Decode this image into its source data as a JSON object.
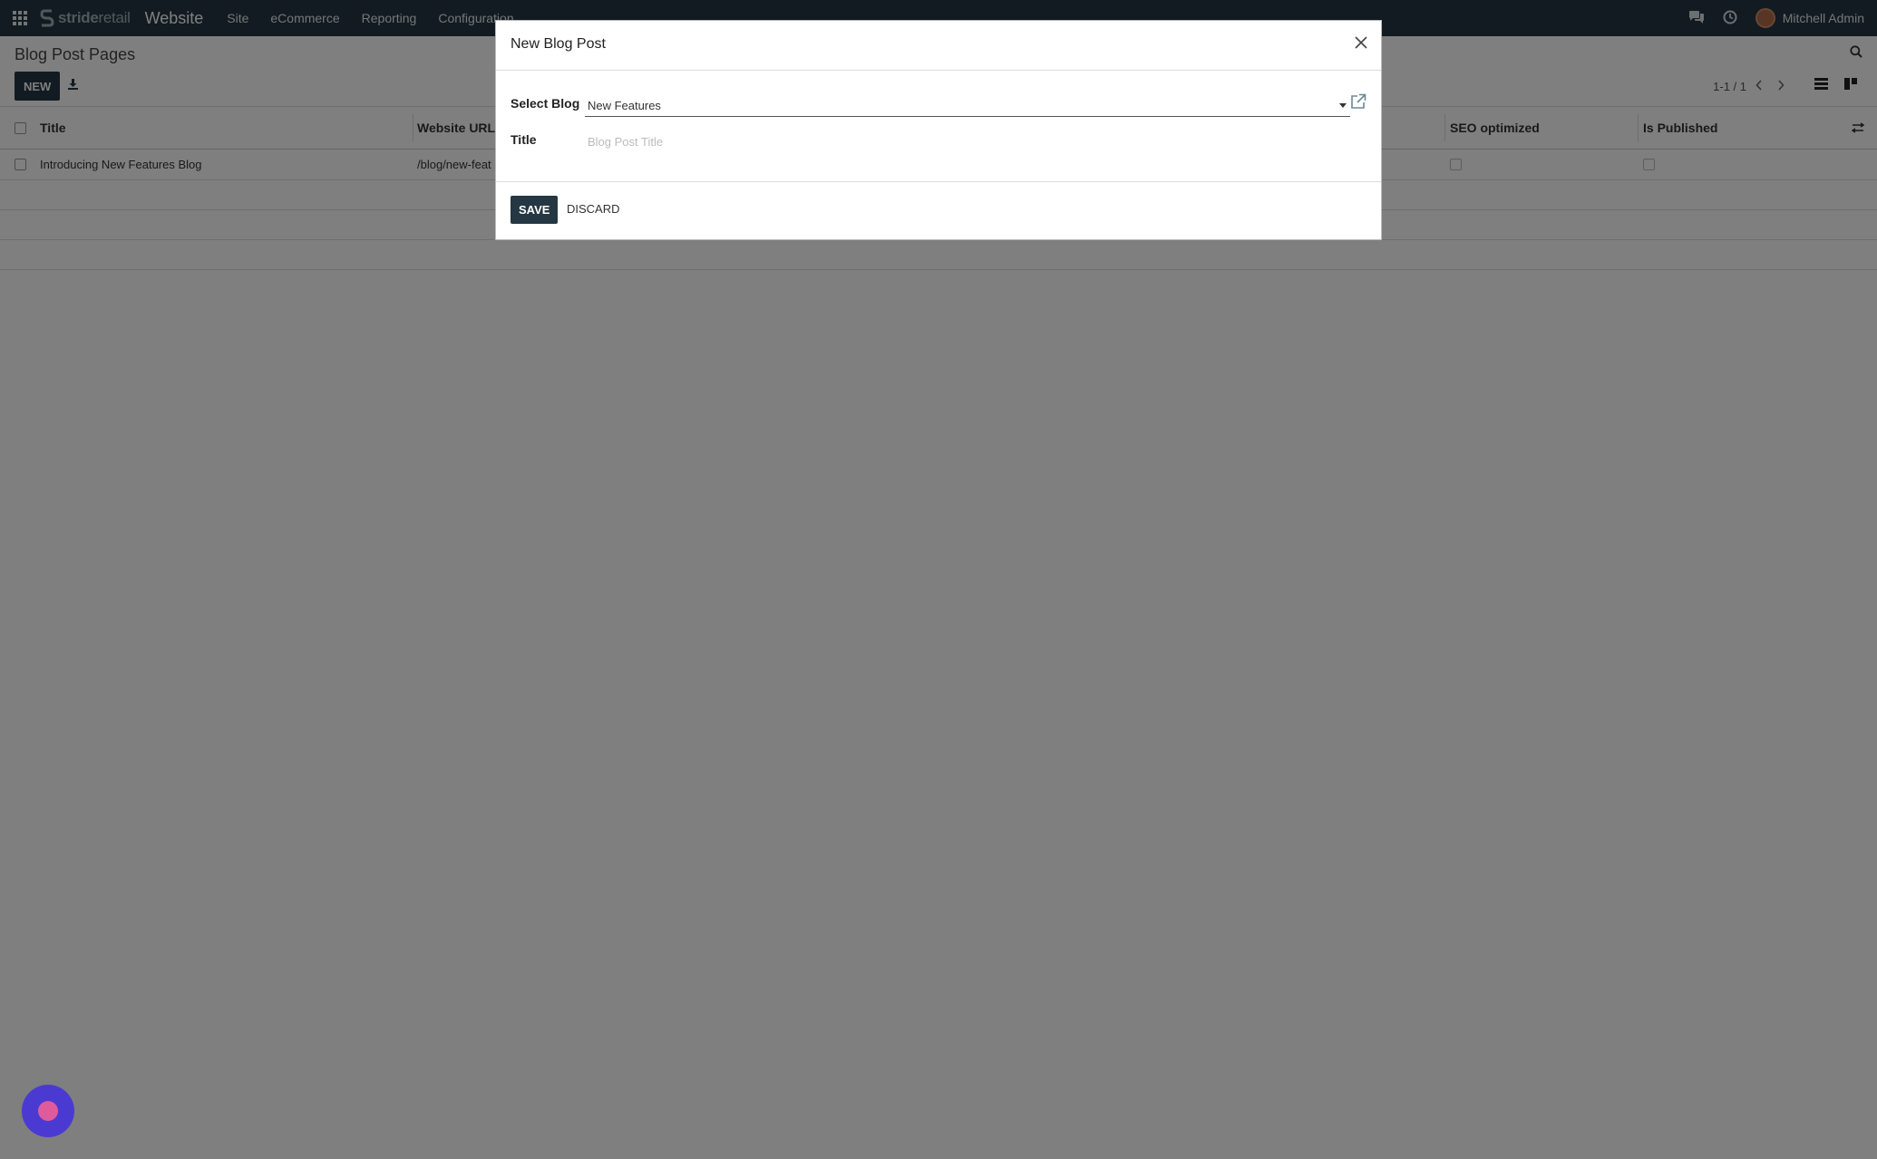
{
  "navbar": {
    "brand_bold": "stride",
    "brand_light": "retail",
    "app_name": "Website",
    "menu": [
      "Site",
      "eCommerce",
      "Reporting",
      "Configuration"
    ],
    "user_name": "Mitchell Admin"
  },
  "control": {
    "breadcrumb": "Blog Post Pages",
    "new_label": "NEW",
    "pager": "1-1 / 1"
  },
  "list": {
    "columns": {
      "title": "Title",
      "website_url": "Website URL",
      "seo_optimized": "SEO optimized",
      "is_published": "Is Published"
    },
    "rows": [
      {
        "title": "Introducing New Features Blog",
        "website_url": "/blog/new-feat",
        "seo_optimized": false,
        "is_published": false
      }
    ]
  },
  "modal": {
    "title": "New Blog Post",
    "select_blog_label": "Select Blog",
    "select_blog_value": "New Features",
    "title_label": "Title",
    "title_placeholder": "Blog Post Title",
    "save_label": "SAVE",
    "discard_label": "DISCARD"
  }
}
